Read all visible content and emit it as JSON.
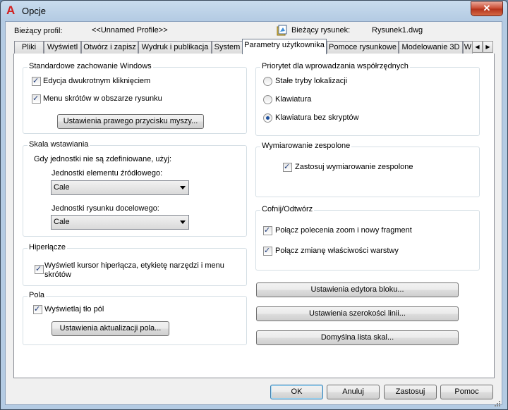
{
  "window": {
    "title": "Opcje",
    "close_label": "✕"
  },
  "header": {
    "profile_label": "Bieżący profil:",
    "profile_value": "<<Unnamed Profile>>",
    "drawing_label": "Bieżący rysunek:",
    "drawing_value": "Rysunek1.dwg"
  },
  "tabs": [
    "Pliki",
    "Wyświetl",
    "Otwórz i zapisz",
    "Wydruk i publikacja",
    "System",
    "Parametry użytkownika",
    "Pomoce rysunkowe",
    "Modelowanie 3D",
    "W"
  ],
  "tab_scroll": {
    "left": "◀",
    "right": "▶"
  },
  "windows_behavior": {
    "title": "Standardowe zachowanie Windows",
    "double_click": {
      "label": "Edycja dwukrotnym kliknięciem",
      "checked": true
    },
    "shortcut_menus": {
      "label": "Menu skrótów w obszarze rysunku",
      "checked": true
    },
    "right_click_button": "Ustawienia prawego przycisku myszy..."
  },
  "insertion_scale": {
    "title": "Skala wstawiania",
    "intro": "Gdy jednostki nie są zdefiniowane, użyj:",
    "source_label": "Jednostki elementu źródłowego:",
    "source_value": "Cale",
    "target_label": "Jednostki rysunku docelowego:",
    "target_value": "Cale"
  },
  "hyperlink": {
    "title": "Hiperłącze",
    "cursor_label_1": "Wyświetl kursor hiperłącza, etykietę narzędzi i menu",
    "cursor_label_2": "skrótów",
    "checked": true
  },
  "fields": {
    "title": "Pola",
    "background": {
      "label": "Wyświetlaj tło pól",
      "checked": true
    },
    "update_button": "Ustawienia aktualizacji pola..."
  },
  "coordinate_priority": {
    "title": "Priorytet dla wprowadzania współrzędnych",
    "options": [
      {
        "label": "Stałe tryby lokalizacji",
        "selected": false
      },
      {
        "label": "Klawiatura",
        "selected": false
      },
      {
        "label": "Klawiatura bez skryptów",
        "selected": true
      }
    ]
  },
  "associative_dimensioning": {
    "title": "Wymiarowanie zespolone",
    "label": "Zastosuj wymiarowanie zespolone",
    "checked": true
  },
  "undo_redo": {
    "title": "Cofnij/Odtwórz",
    "zoom_pan": {
      "label": "Połącz polecenia zoom i nowy fragment",
      "checked": true
    },
    "layer_props": {
      "label": "Połącz zmianę właściwości warstwy",
      "checked": true
    }
  },
  "side_buttons": {
    "block_editor": "Ustawienia edytora bloku...",
    "lineweight": "Ustawienia szerokości linii...",
    "scale_list": "Domyślna lista skal..."
  },
  "footer": {
    "ok": "OK",
    "cancel": "Anuluj",
    "apply": "Zastosuj",
    "help": "Pomoc"
  }
}
